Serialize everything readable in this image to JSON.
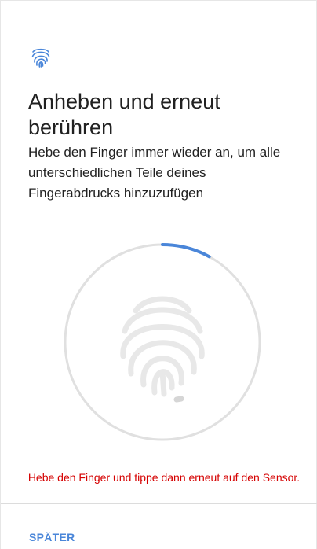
{
  "header": {
    "icon": "fingerprint-icon"
  },
  "content": {
    "title": "Anheben und erneut berühren",
    "description": "Hebe den Finger immer wieder an, um alle unterschiedlichen Teile deines Fingerabdrucks hinzuzufügen"
  },
  "sensor": {
    "icon": "fingerprint-icon",
    "progress": 0.08
  },
  "status": {
    "error_message": "Hebe den Finger und tippe dann erneut auf den Sensor."
  },
  "footer": {
    "later_label": "SPÄTER"
  },
  "colors": {
    "accent": "#4a86d9",
    "error": "#d50000",
    "ring": "#e0e0e0",
    "fingerprint": "#e8e8e8"
  }
}
